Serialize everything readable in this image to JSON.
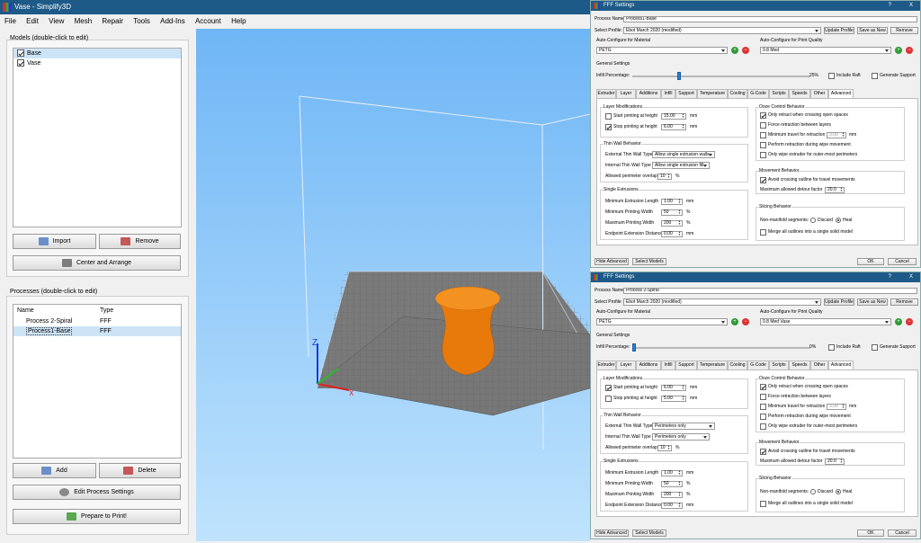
{
  "window": {
    "title": "Vase - Simplify3D"
  },
  "menu": [
    "File",
    "Edit",
    "View",
    "Mesh",
    "Repair",
    "Tools",
    "Add-Ins",
    "Account",
    "Help"
  ],
  "models": {
    "label": "Models (double-click to edit)",
    "items": [
      "Base",
      "Vase"
    ],
    "import": "Import",
    "remove": "Remove",
    "center": "Center and Arrange"
  },
  "processes": {
    "label": "Processes (double-click to edit)",
    "col_name": "Name",
    "col_type": "Type",
    "rows": [
      {
        "name": "Process 2-Spiral",
        "type": "FFF"
      },
      {
        "name": "Process1-Base",
        "type": "FFF"
      }
    ],
    "add": "Add",
    "delete": "Delete",
    "edit": "Edit Process Settings",
    "prepare": "Prepare to Print!"
  },
  "viewport": {
    "axis_z": "Z",
    "axis_x": "X"
  },
  "dialogs": [
    {
      "title": "FFF Settings",
      "q": "?",
      "x": "X",
      "process_name_label": "Process Name:",
      "process_name": "Process1-Base",
      "select_profile_label": "Select Profile:",
      "profile": "Ebot March 2020 (modified)",
      "update": "Update Profile",
      "save_new": "Save as New",
      "remove": "Remove",
      "material_label": "Auto-Configure for Material",
      "material": "PETG",
      "quality_label": "Auto-Configure for Print Quality",
      "quality": "0.8 Med",
      "general": "General Settings",
      "infill_label": "Infill Percentage:",
      "infill": "25%",
      "infill_frac": 0.25,
      "raft": "Include Raft",
      "support": "Generate Support",
      "tabs": [
        "Extruder",
        "Layer",
        "Additions",
        "Infill",
        "Support",
        "Temperature",
        "Cooling",
        "G-Code",
        "Scripts",
        "Speeds",
        "Other",
        "Advanced"
      ],
      "layer_mod": "Layer Modifications",
      "start_h": "Start printing at height",
      "start_v": "15.00",
      "start_on": false,
      "stop_h": "Stop printing at height",
      "stop_v": "6.00",
      "stop_on": true,
      "mm": "mm",
      "pct": "%",
      "thin": "Thin Wall Behavior",
      "ext_thin": "External Thin Wall Type",
      "ext_thin_v": "Allow single extrusion walls",
      "int_thin": "Internal Thin Wall Type",
      "int_thin_v": "Allow single extrusion fill",
      "overlap": "Allowed perimeter overlap",
      "overlap_v": "10",
      "single": "Single Extrusions",
      "min_len": "Minimum Extrusion Length",
      "min_len_v": "1.00",
      "min_w": "Minimum Printing Width",
      "min_w_v": "50",
      "max_w": "Maximum Printing Width",
      "max_w_v": "200",
      "endpoint": "Endpoint Extension Distance",
      "endpoint_v": "0.00",
      "ooze": "Ooze Control Behavior",
      "o1": "Only retract when crossing open spaces",
      "o2": "Force retraction between layers",
      "o3": "Minimum travel for retraction",
      "o3v": "3.00",
      "o4": "Perform retraction during wipe movement",
      "o5": "Only wipe extruder for outer-most perimeters",
      "move": "Movement Behavior",
      "m1": "Avoid crossing outline for travel movements",
      "m2": "Maximum allowed detour factor",
      "m2v": "20.0",
      "slice": "Slicing Behavior",
      "nonman": "Non-manifold segments:",
      "discard": "Discard",
      "heal": "Heal",
      "merge": "Merge all outlines into a single solid model",
      "hide": "Hide Advanced",
      "select_models": "Select Models",
      "ok": "OK",
      "cancel": "Cancel"
    },
    {
      "title": "FFF Settings",
      "q": "?",
      "x": "X",
      "process_name_label": "Process Name:",
      "process_name": "Process 2-Spiral",
      "select_profile_label": "Select Profile:",
      "profile": "Ebot March 2020 (modified)",
      "update": "Update Profile",
      "save_new": "Save as New",
      "remove": "Remove",
      "material_label": "Auto-Configure for Material",
      "material": "PETG",
      "quality_label": "Auto-Configure for Print Quality",
      "quality": "0.8 Med Vase",
      "general": "General Settings",
      "infill_label": "Infill Percentage:",
      "infill": "0%",
      "infill_frac": 0,
      "raft": "Include Raft",
      "support": "Generate Support",
      "tabs": [
        "Extruder",
        "Layer",
        "Additions",
        "Infill",
        "Support",
        "Temperature",
        "Cooling",
        "G-Code",
        "Scripts",
        "Speeds",
        "Other",
        "Advanced"
      ],
      "layer_mod": "Layer Modifications",
      "start_h": "Start printing at height",
      "start_v": "6.00",
      "start_on": true,
      "stop_h": "Stop printing at height",
      "stop_v": "5.00",
      "stop_on": false,
      "mm": "mm",
      "pct": "%",
      "thin": "Thin Wall Behavior",
      "ext_thin": "External Thin Wall Type",
      "ext_thin_v": "Perimeters only",
      "int_thin": "Internal Thin Wall Type",
      "int_thin_v": "Perimeters only",
      "overlap": "Allowed perimeter overlap",
      "overlap_v": "10",
      "single": "Single Extrusions",
      "min_len": "Minimum Extrusion Length",
      "min_len_v": "1.00",
      "min_w": "Minimum Printing Width",
      "min_w_v": "50",
      "max_w": "Maximum Printing Width",
      "max_w_v": "200",
      "endpoint": "Endpoint Extension Distance",
      "endpoint_v": "0.00",
      "ooze": "Ooze Control Behavior",
      "o1": "Only retract when crossing open spaces",
      "o2": "Force retraction between layers",
      "o3": "Minimum travel for retraction",
      "o3v": "3.00",
      "o4": "Perform retraction during wipe movement",
      "o5": "Only wipe extruder for outer-most perimeters",
      "move": "Movement Behavior",
      "m1": "Avoid crossing outline for travel movements",
      "m2": "Maximum allowed detour factor",
      "m2v": "20.0",
      "slice": "Slicing Behavior",
      "nonman": "Non-manifold segments:",
      "discard": "Discard",
      "heal": "Heal",
      "merge": "Merge all outlines into a single solid model",
      "hide": "Hide Advanced",
      "select_models": "Select Models",
      "ok": "OK",
      "cancel": "Cancel"
    }
  ]
}
